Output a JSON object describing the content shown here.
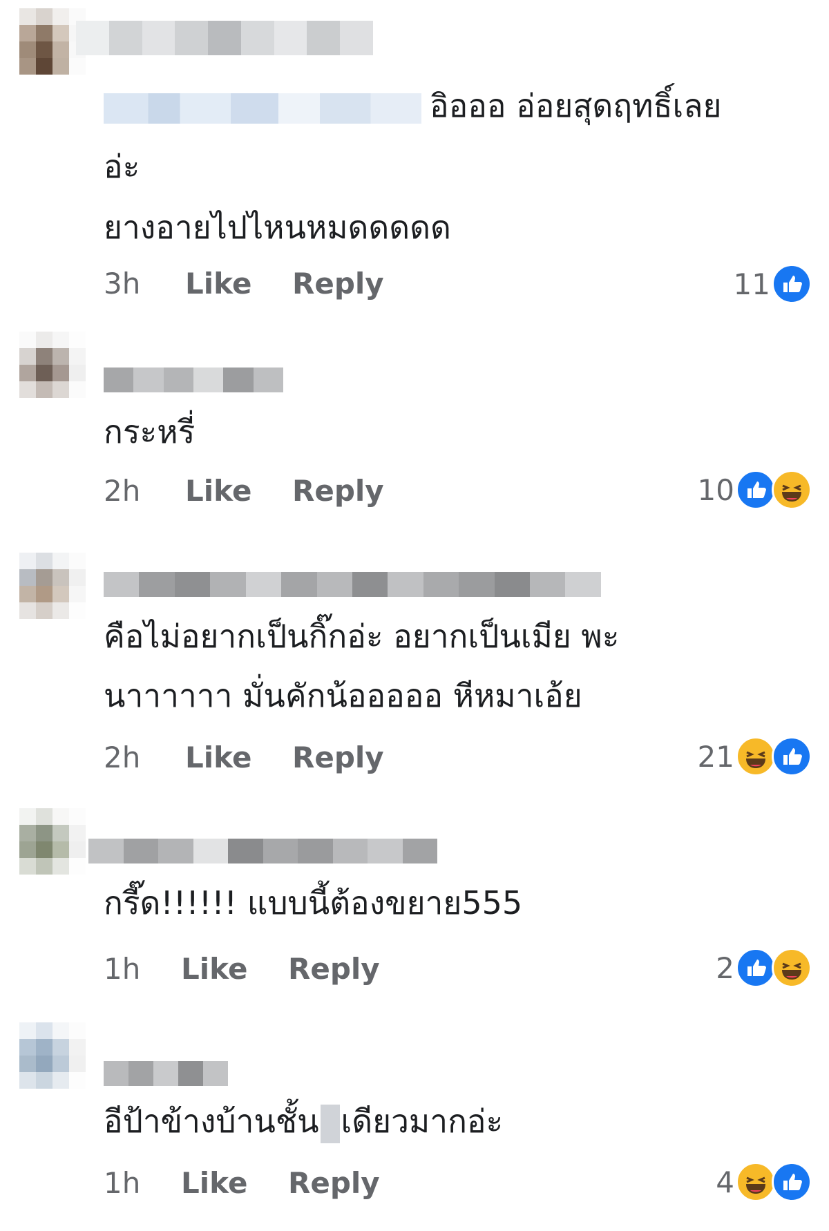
{
  "comments": [
    {
      "text_lines": [
        "อิอออ อ่อยสุดฤทธิ์เลย",
        "อ่ะ",
        "ยางอายไปไหนหมดดดดด"
      ],
      "time": "3h",
      "like_label": "Like",
      "reply_label": "Reply",
      "reaction_count": "11",
      "reactions": [
        "like-icon"
      ]
    },
    {
      "text_lines": [
        "กระหรี่"
      ],
      "time": "2h",
      "like_label": "Like",
      "reply_label": "Reply",
      "reaction_count": "10",
      "reactions": [
        "like-icon",
        "haha-icon"
      ]
    },
    {
      "text_lines": [
        "คือไม่อยากเป็นกิ๊กอ่ะ อยากเป็นเมีย พะ",
        "นาาาาาา มั่นคักน้อออออ หีหมาเอ้ย"
      ],
      "time": "2h",
      "like_label": "Like",
      "reply_label": "Reply",
      "reaction_count": "21",
      "reactions": [
        "haha-icon",
        "like-icon"
      ]
    },
    {
      "text_lines": [
        "กรี๊ด!!!!!!  แบบนี้ต้องขยาย555"
      ],
      "time": "1h",
      "like_label": "Like",
      "reply_label": "Reply",
      "reaction_count": "2",
      "reactions": [
        "like-icon",
        "haha-icon"
      ]
    },
    {
      "text_lines": [
        "อีป้าข้างบ้านชั้น",
        "เดียวมากอ่ะ"
      ],
      "time": "1h",
      "like_label": "Like",
      "reply_label": "Reply",
      "reaction_count": "4",
      "reactions": [
        "haha-icon",
        "like-icon"
      ]
    }
  ],
  "colors": {
    "like_blue": "#1877f2",
    "haha_yellow": "#f7b928",
    "meta_gray": "#65676b",
    "text": "#1c1e21"
  }
}
